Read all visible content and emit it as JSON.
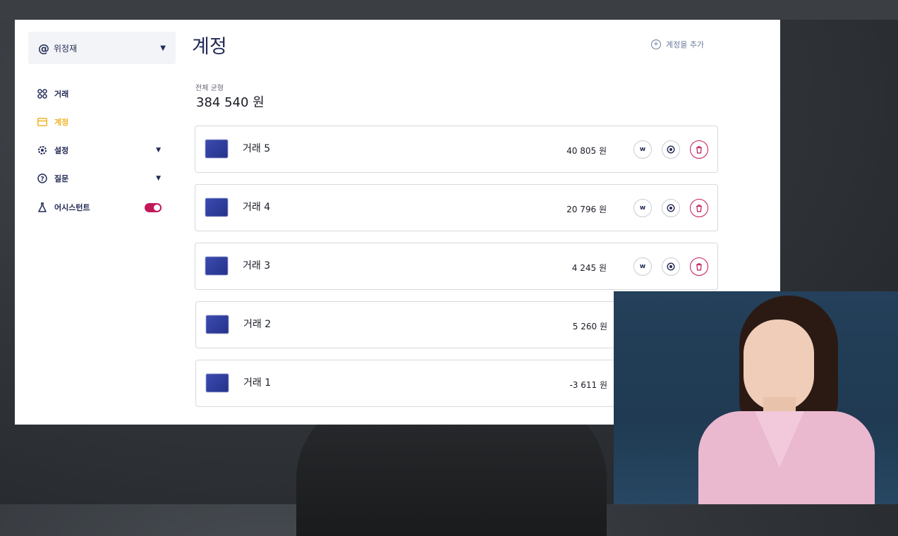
{
  "sidebar": {
    "account_selector": {
      "icon": "at-icon",
      "name": "위정재"
    },
    "items": [
      {
        "label": "거래",
        "icon": "grid-icon"
      },
      {
        "label": "계정",
        "icon": "card-icon",
        "active": true
      },
      {
        "label": "설정",
        "icon": "gear-icon"
      },
      {
        "label": "질문",
        "icon": "question-icon"
      },
      {
        "label": "어시스턴트",
        "icon": "flask-icon",
        "toggle_on": true
      }
    ]
  },
  "main": {
    "title": "계정",
    "add_account_label": "계정을 추가",
    "total_label": "전체 균형",
    "total_amount": "384 540 원",
    "transactions": [
      {
        "name": "거래 5",
        "amount": "40 805 원"
      },
      {
        "name": "거래 4",
        "amount": "20 796 원"
      },
      {
        "name": "거래 3",
        "amount": "4 245 원"
      },
      {
        "name": "거래 2",
        "amount": "5 260 원"
      },
      {
        "name": "거래 1",
        "amount": "-3 611 원"
      }
    ],
    "row_action_w_label": "w"
  },
  "colors": {
    "navy": "#222a55",
    "active": "#f0b429",
    "accent": "#c2185b"
  }
}
